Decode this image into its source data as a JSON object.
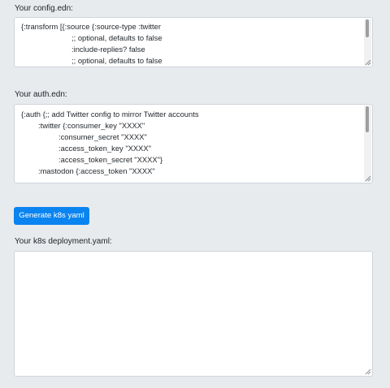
{
  "config_section": {
    "label": "Your config.edn:",
    "lines": [
      "{:transform [{:source {:source-type :twitter",
      ";; optional, defaults to false",
      ":include-replies? false",
      ";; optional, defaults to false"
    ]
  },
  "auth_section": {
    "label": "Your auth.edn:",
    "lines": [
      "{:auth {;; add Twitter config to mirror Twitter accounts",
      ":twitter {:consumer_key \"XXXX\"",
      ":consumer_secret \"XXXX\"",
      ":access_token_key \"XXXX\"",
      ":access_token_secret \"XXXX\"}",
      ":mastodon {:access_token \"XXXX\""
    ]
  },
  "generate_button": {
    "label": "Generate k8s yaml"
  },
  "output_section": {
    "label": "Your k8s deployment.yaml:",
    "value": ""
  },
  "colors": {
    "page_background": "#e8ebee",
    "button_primary": "#0a84f0",
    "textarea_background": "#ffffff",
    "textarea_border": "#ced4da"
  },
  "icons": {
    "resize_grip": "resize-grip-icon"
  }
}
